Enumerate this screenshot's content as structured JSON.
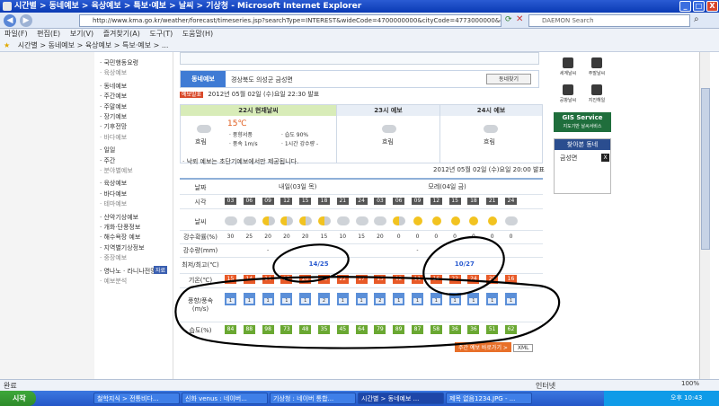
{
  "window": {
    "title": "시간별 > 동네예보 > 육상예보 > 특보·예보 > 날씨 > 기상청 - Microsoft Internet Explorer",
    "controls": [
      "_",
      "□",
      "X"
    ]
  },
  "address": {
    "url": "http://www.kma.go.kr/weather/forecast/timeseries.jsp?searchType=INTEREST&wideCode=4700000000&cityCode=4773000000&dongCode",
    "search_placeholder": "DAEMON Search"
  },
  "menu": [
    "파일(F)",
    "편집(E)",
    "보기(V)",
    "즐겨찾기(A)",
    "도구(T)",
    "도움말(H)"
  ],
  "fav_tab": "시간별 > 동네예보 > 육상예보 > 특보·예보 > ...",
  "sidebar": {
    "items": [
      {
        "label": "· 국민행동요령",
        "type": "item"
      },
      {
        "label": "· 육상예보",
        "type": "section"
      },
      {
        "label": "· 동네예보",
        "type": "item"
      },
      {
        "label": "· 주간예보",
        "type": "item"
      },
      {
        "label": "· 주말예보",
        "type": "item"
      },
      {
        "label": "· 장기예보",
        "type": "item"
      },
      {
        "label": "· 기후전망",
        "type": "item"
      },
      {
        "label": "· 바다예보",
        "type": "section"
      },
      {
        "label": "· 일일",
        "type": "item"
      },
      {
        "label": "· 주간",
        "type": "item"
      },
      {
        "label": "· 분야별예보",
        "type": "section"
      },
      {
        "label": "· 육상예보",
        "type": "item"
      },
      {
        "label": "· 바다예보",
        "type": "item"
      },
      {
        "label": "· 테마예보",
        "type": "section"
      },
      {
        "label": "· 산악기상예보",
        "type": "item"
      },
      {
        "label": "· 개화·단풍정보",
        "type": "item"
      },
      {
        "label": "· 해수욕장 예보",
        "type": "item"
      },
      {
        "label": "· 지역별기상정보",
        "type": "item"
      },
      {
        "label": "· 중장예보",
        "type": "section"
      },
      {
        "label": "· 영나노 · 라니나전망",
        "type": "item"
      },
      {
        "label": "· 예보분석",
        "type": "section"
      }
    ],
    "badge": "자료"
  },
  "location": {
    "label": "동네예보",
    "value": "경상북도 의성군 금성면",
    "button": "동네찾기"
  },
  "issued": {
    "tag": "예보발표",
    "text": "2012년 05월 02일 (수)요일 22:30 발표"
  },
  "cards": [
    {
      "header": "22시 현재날씨",
      "cond": "흐림",
      "temp": "15℃",
      "details": [
        "· 풍향서풍",
        "· 습도 90%",
        "· 풍속 1m/s",
        "· 1시간 강수량 -"
      ]
    },
    {
      "header": "23시 예보",
      "cond": "흐림"
    },
    {
      "header": "24시 예보",
      "cond": "흐림"
    }
  ],
  "note": "· 낙뢰 예보는 초단기예보에서만 제공됩니다.",
  "table_stamp": "2012년 05월 02일 (수)요일 20:00 발표",
  "table": {
    "date_label": "날짜",
    "dates": [
      "내일(03일 목)",
      "모레(04일 금)"
    ],
    "hour_label": "시각",
    "hours": [
      "03",
      "06",
      "09",
      "12",
      "15",
      "18",
      "21",
      "24",
      "03",
      "06",
      "09",
      "12",
      "15",
      "18",
      "21",
      "24"
    ],
    "weather_label": "날씨",
    "weather": [
      "cloud",
      "cloud",
      "suncloud",
      "suncloud",
      "suncloud",
      "suncloud",
      "cloud",
      "cloud",
      "cloud",
      "suncloud",
      "sun",
      "sun",
      "sun",
      "sun",
      "sun",
      "cloud"
    ],
    "pop_label": "강수확률(%)",
    "pop": [
      "30",
      "25",
      "20",
      "20",
      "20",
      "15",
      "10",
      "15",
      "20",
      "0",
      "0",
      "0",
      "0",
      "0",
      "0",
      "0"
    ],
    "precip_label": "강수량(mm)",
    "precip": [
      "",
      "",
      "-",
      "",
      "",
      "",
      "",
      "",
      "",
      "",
      "-",
      "",
      "",
      "",
      "",
      ""
    ],
    "minmax_label": "최저/최고(℃)",
    "minmax1": "14/25",
    "minmax2": "10/27",
    "temp_label": "기온(℃)",
    "temps": [
      "15",
      "14",
      "14",
      "17",
      "20",
      "23",
      "22",
      "17",
      "15",
      "12",
      "11",
      "16",
      "22",
      "24",
      "20",
      "16"
    ],
    "wind_label": "풍향/풍속(m/s)",
    "winds": [
      "1",
      "1",
      "1",
      "1",
      "1",
      "2",
      "1",
      "1",
      "2",
      "1",
      "1",
      "1",
      "1",
      "1",
      "1",
      "1"
    ],
    "humid_label": "습도(%)",
    "humid": [
      "84",
      "88",
      "98",
      "73",
      "48",
      "35",
      "45",
      "64",
      "79",
      "89",
      "87",
      "58",
      "36",
      "36",
      "51",
      "62"
    ]
  },
  "right": {
    "icons": [
      "세계날씨",
      "주말날씨",
      "공항날씨",
      "지진해일"
    ],
    "gis": [
      "GIS Service",
      "지도기반 날씨서비스"
    ],
    "recent_title": "찾아본 동네",
    "recent_item": "금성면",
    "recent_close": "X"
  },
  "buttons": {
    "weekly": "주간 예보 바로가기 >",
    "xml": "XML"
  },
  "status": {
    "left": "완료",
    "right": "인터넷"
  },
  "taskbar": {
    "start": "시작",
    "tasks": [
      "철학지식 > 전통비다...",
      "신화 venus : 네이버...",
      "기상청 : 네이버 통합...",
      "시간별 > 동네예보 ...",
      "제목 없음1234.JPG - ..."
    ],
    "zoom": "100%",
    "clock": "오후 10:43"
  }
}
